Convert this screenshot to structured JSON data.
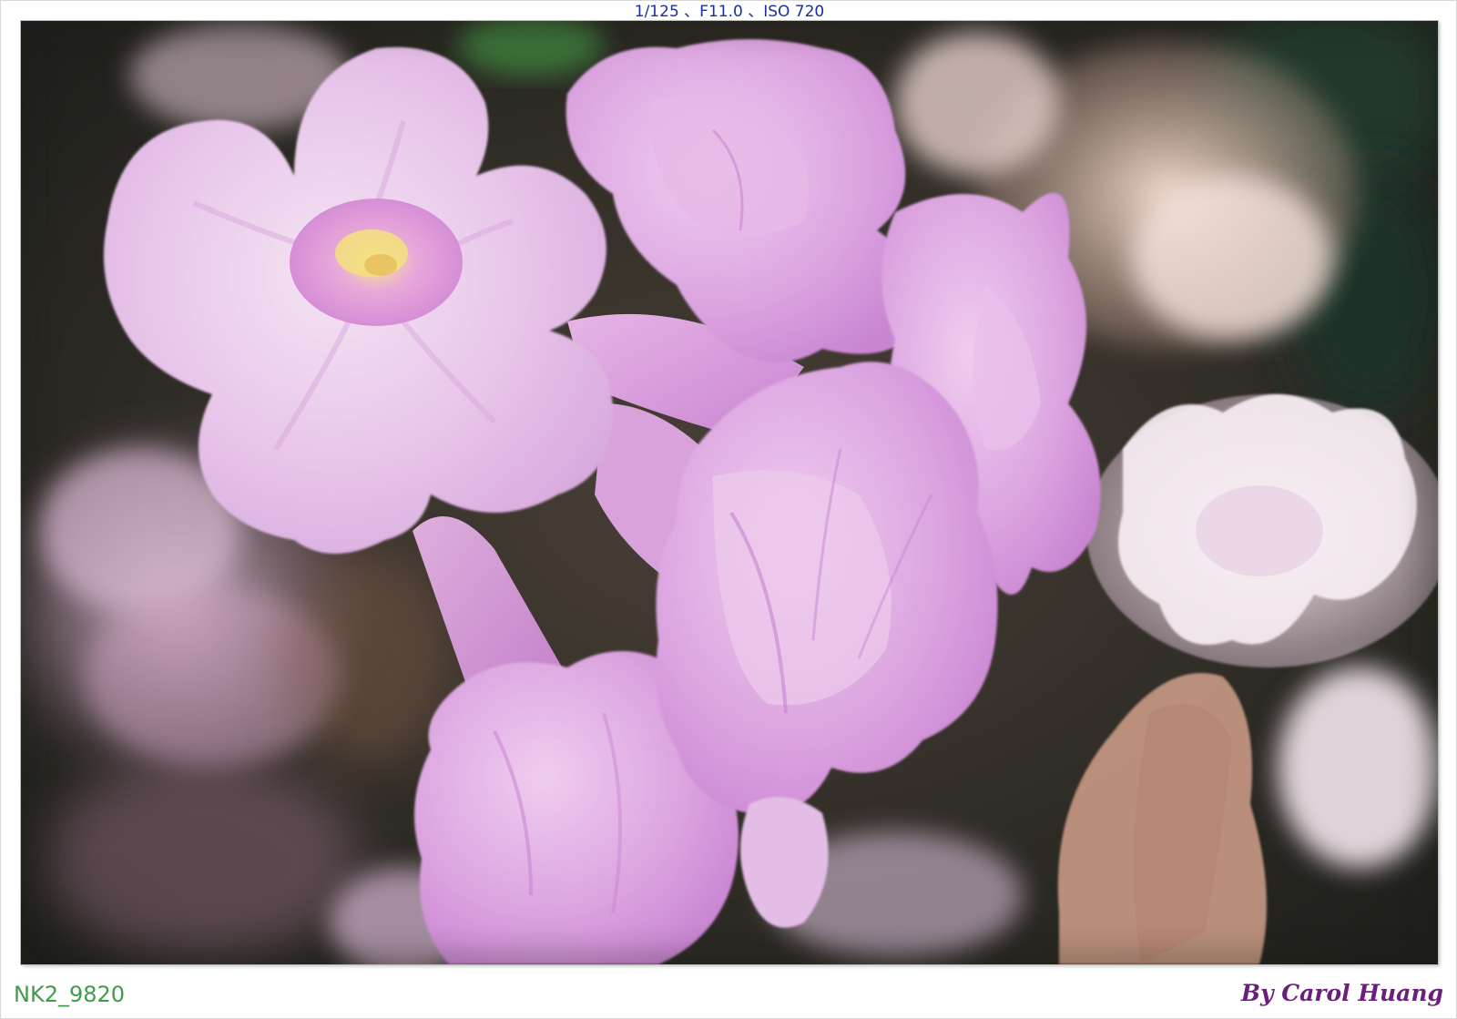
{
  "photo": {
    "exif_line": "1/125 、F11.0 、ISO 720",
    "file_id": "NK2_9820",
    "credit": "By Carol Huang"
  },
  "colors": {
    "exif_text": "#1a2f9c",
    "file_id_text": "#3f9c4a",
    "credit_text": "#6a1f7a",
    "petal_main": "#e8c6ea",
    "petal_deep": "#d394dc",
    "background_dark": "#2c2a24"
  }
}
